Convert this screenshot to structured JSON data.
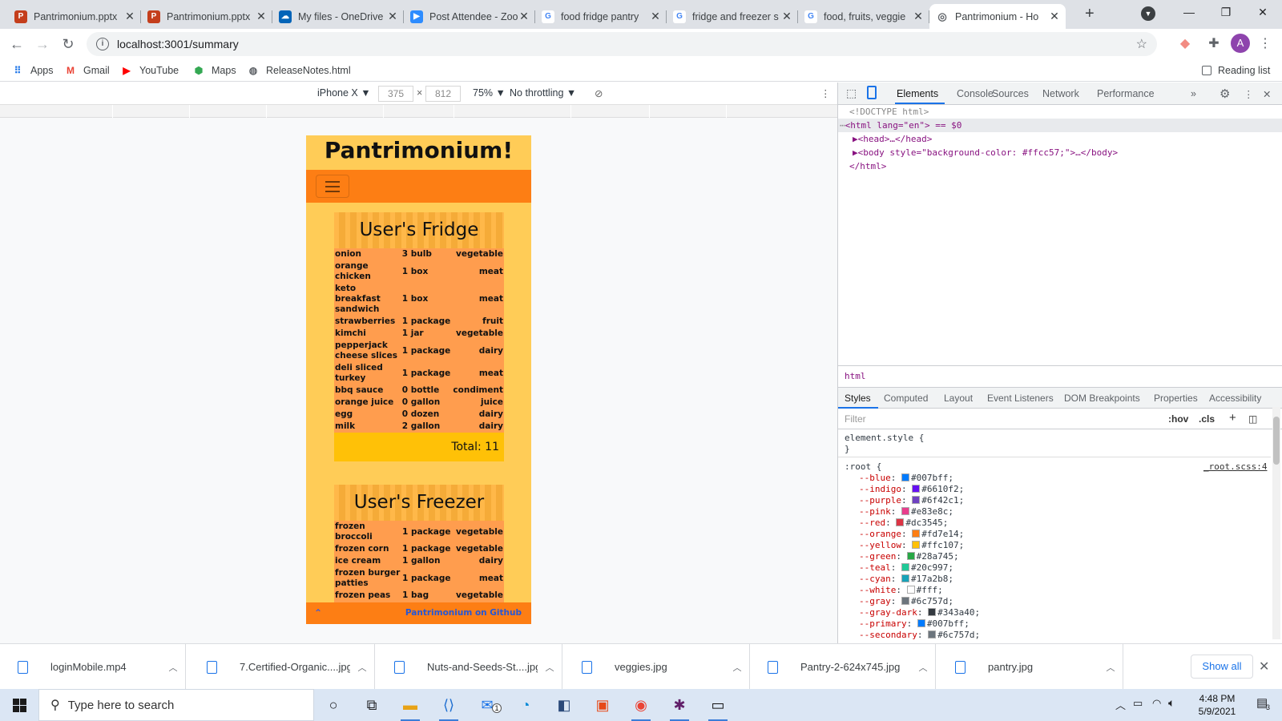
{
  "browser": {
    "tabs": [
      {
        "title": "Pantrimonium.pptx",
        "icon": "powerpoint-icon",
        "color": "#c43e1c"
      },
      {
        "title": "Pantrimonium.pptx",
        "icon": "powerpoint-icon",
        "color": "#c43e1c"
      },
      {
        "title": "My files - OneDrive",
        "icon": "onedrive-icon",
        "color": "#0364b8"
      },
      {
        "title": "Post Attendee - Zoom",
        "icon": "zoom-icon",
        "color": "#2d8cff"
      },
      {
        "title": "food fridge pantry",
        "icon": "google-icon",
        "color": "#4285f4"
      },
      {
        "title": "fridge and freezer s",
        "icon": "google-icon",
        "color": "#4285f4"
      },
      {
        "title": "food, fruits, veggie",
        "icon": "google-icon",
        "color": "#4285f4"
      },
      {
        "title": "Pantrimonium - Ho",
        "icon": "globe-icon",
        "color": "#5f6368",
        "active": true
      }
    ],
    "new_tab": "+",
    "url": "localhost:3001/summary",
    "profile_initial": "A",
    "bookmarks": [
      {
        "label": "Apps",
        "icon": "apps-grid-icon"
      },
      {
        "label": "Gmail",
        "icon": "gmail-icon"
      },
      {
        "label": "YouTube",
        "icon": "youtube-icon"
      },
      {
        "label": "Maps",
        "icon": "maps-icon"
      },
      {
        "label": "ReleaseNotes.html",
        "icon": "globe-icon"
      }
    ],
    "reading_list": "Reading list"
  },
  "device_toolbar": {
    "device": "iPhone X",
    "width": "375",
    "height": "812",
    "times": "×",
    "zoom": "75%",
    "throttling": "No throttling"
  },
  "app": {
    "title": "Pantrimonium!",
    "fridge": {
      "heading": "User's Fridge",
      "items": [
        {
          "name": "onion",
          "qty": "3 bulb",
          "category": "vegetable"
        },
        {
          "name": "orange chicken",
          "qty": "1 box",
          "category": "meat"
        },
        {
          "name": "keto breakfast sandwich",
          "qty": "1 box",
          "category": "meat"
        },
        {
          "name": "strawberries",
          "qty": "1 package",
          "category": "fruit"
        },
        {
          "name": "kimchi",
          "qty": "1 jar",
          "category": "vegetable"
        },
        {
          "name": "pepperjack cheese slices",
          "qty": "1 package",
          "category": "dairy"
        },
        {
          "name": "deli sliced turkey",
          "qty": "1 package",
          "category": "meat"
        },
        {
          "name": "bbq sauce",
          "qty": "0 bottle",
          "category": "condiment"
        },
        {
          "name": "orange juice",
          "qty": "0 gallon",
          "category": "juice"
        },
        {
          "name": "egg",
          "qty": "0 dozen",
          "category": "dairy"
        },
        {
          "name": "milk",
          "qty": "2 gallon",
          "category": "dairy"
        }
      ],
      "total": "Total: 11"
    },
    "freezer": {
      "heading": "User's Freezer",
      "items": [
        {
          "name": "frozen broccoli",
          "qty": "1 package",
          "category": "vegetable"
        },
        {
          "name": "frozen corn",
          "qty": "1 package",
          "category": "vegetable"
        },
        {
          "name": "ice cream",
          "qty": "1 gallon",
          "category": "dairy"
        },
        {
          "name": "frozen burger patties",
          "qty": "1 package",
          "category": "meat"
        },
        {
          "name": "frozen peas",
          "qty": "1 bag",
          "category": "vegetable"
        }
      ]
    },
    "footer": {
      "up_arrow": "⌃",
      "github_link": "Pantrimonium on Github"
    }
  },
  "devtools": {
    "tabs": [
      "Elements",
      "Console",
      "Sources",
      "Network",
      "Performance"
    ],
    "more": "»",
    "dom_lines": [
      {
        "text": "<!DOCTYPE html>"
      },
      {
        "text": "<html lang=\"en\"> == $0"
      },
      {
        "text": "▶<head>…</head>"
      },
      {
        "text": "▶<body style=\"background-color: #ffcc57;\">…</body>"
      },
      {
        "text": "</html>"
      }
    ],
    "breadcrumb": "html",
    "style_tabs": [
      "Styles",
      "Computed",
      "Layout",
      "Event Listeners",
      "DOM Breakpoints",
      "Properties",
      "Accessibility"
    ],
    "filter_placeholder": "Filter",
    "hov": ":hov",
    "cls": ".cls",
    "element_style": "element.style {",
    "close_brace": "}",
    "root_selector": ":root {",
    "root_source": "_root.scss:4",
    "css_vars": [
      {
        "name": "--blue",
        "value": "#007bff"
      },
      {
        "name": "--indigo",
        "value": "#6610f2"
      },
      {
        "name": "--purple",
        "value": "#6f42c1"
      },
      {
        "name": "--pink",
        "value": "#e83e8c"
      },
      {
        "name": "--red",
        "value": "#dc3545"
      },
      {
        "name": "--orange",
        "value": "#fd7e14"
      },
      {
        "name": "--yellow",
        "value": "#ffc107"
      },
      {
        "name": "--green",
        "value": "#28a745"
      },
      {
        "name": "--teal",
        "value": "#20c997"
      },
      {
        "name": "--cyan",
        "value": "#17a2b8"
      },
      {
        "name": "--white",
        "value": "#fff"
      },
      {
        "name": "--gray",
        "value": "#6c757d"
      },
      {
        "name": "--gray-dark",
        "value": "#343a40"
      },
      {
        "name": "--primary",
        "value": "#007bff"
      },
      {
        "name": "--secondary",
        "value": "#6c757d"
      }
    ]
  },
  "downloads": {
    "items": [
      "loginMobile.mp4",
      "7.Certified-Organic....jpg",
      "Nuts-and-Seeds-St....jpg",
      "veggies.jpg",
      "Pantry-2-624x745.jpg",
      "pantry.jpg"
    ],
    "show_all": "Show all"
  },
  "taskbar": {
    "search_placeholder": "Type here to search",
    "time": "4:48 PM",
    "date": "5/9/2021",
    "notification_count": "3",
    "mail_badge": "1"
  }
}
